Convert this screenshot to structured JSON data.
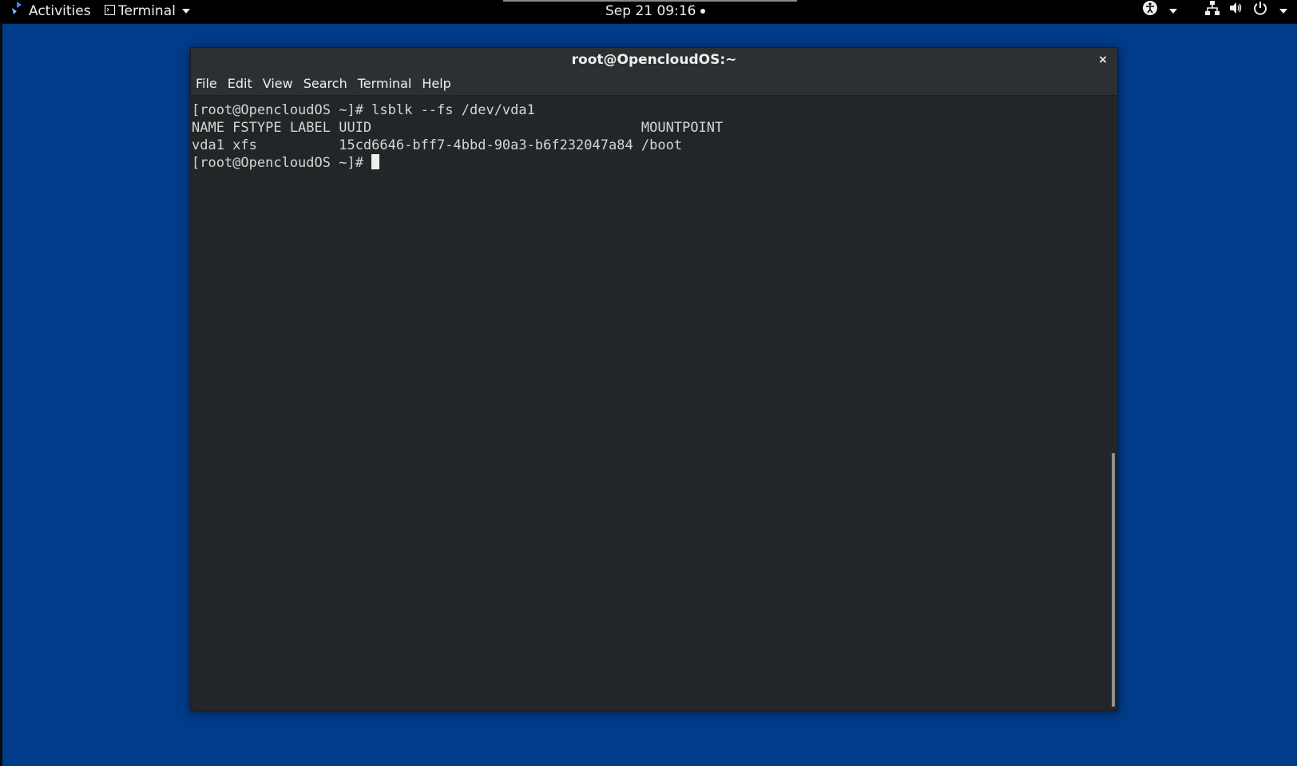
{
  "topbar": {
    "activities_label": "Activities",
    "app_menu_label": "Terminal",
    "clock": "Sep 21  09:16"
  },
  "window": {
    "title": "root@OpencloudOS:~",
    "close_glyph": "×",
    "menu": [
      "File",
      "Edit",
      "View",
      "Search",
      "Terminal",
      "Help"
    ]
  },
  "terminal": {
    "lines": [
      "[root@OpencloudOS ~]# lsblk --fs /dev/vda1",
      "NAME FSTYPE LABEL UUID                                 MOUNTPOINT",
      "vda1 xfs          15cd6646-bff7-4bbd-90a3-b6f232047a84 /boot"
    ],
    "prompt": "[root@OpencloudOS ~]# "
  },
  "icons": {
    "activities": "app-logo-icon",
    "app_menu": "terminal-small-icon",
    "accessibility": "accessibility-icon",
    "network": "network-wired-icon",
    "volume": "volume-icon",
    "power": "power-icon"
  },
  "colors": {
    "desktop": "#003c8a",
    "topbar": "#000000",
    "terminal_bg": "#232629",
    "terminal_fg": "#d3d7cf"
  }
}
